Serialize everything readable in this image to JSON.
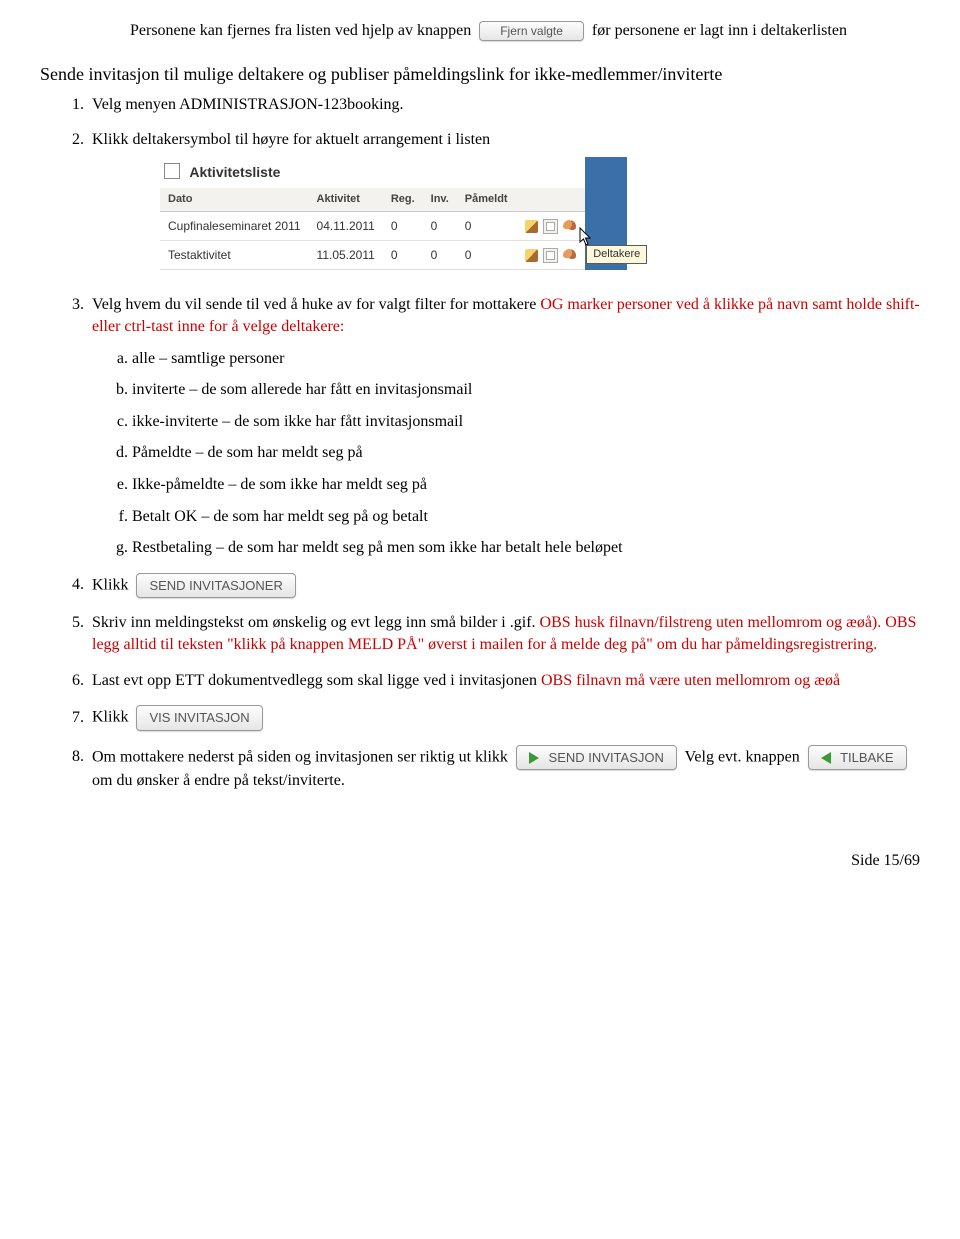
{
  "intro": {
    "part1": "Personene kan fjernes fra listen ved hjelp av knappen ",
    "button_fjern": "Fjern valgte",
    "part2": " før personene er lagt inn i deltakerlisten"
  },
  "heading": "Sende invitasjon til mulige deltakere og publiser påmeldingslink for ikke-medlemmer/inviterte",
  "steps": {
    "s1": "Velg menyen ADMINISTRASJON-123booking.",
    "s2": "Klikk deltakersymbol til høyre for aktuelt arrangement i listen",
    "s3_a": "Velg hvem du vil sende til ved å huke av for valgt filter for mottakere ",
    "s3_b": "OG marker personer ved å klikke på navn samt holde shift- eller ctrl-tast inne for å velge deltakere:",
    "s3_sub": {
      "a": "alle – samtlige personer",
      "b": "inviterte – de som allerede har fått en invitasjonsmail",
      "c": "ikke-inviterte – de som ikke har fått invitasjonsmail",
      "d": "Påmeldte – de som har meldt seg på",
      "e": "Ikke-påmeldte – de som ikke har meldt seg på",
      "f": "Betalt OK – de som har meldt seg på og betalt",
      "g": "Restbetaling – de som har meldt seg på men som ikke har betalt hele beløpet"
    },
    "s4_a": "Klikk ",
    "s4_button": "SEND INVITASJONER",
    "s5_a": "Skriv inn meldingstekst om ønskelig og evt legg inn små bilder i .gif. ",
    "s5_b": "OBS husk filnavn/filstreng uten mellomrom og æøå). OBS legg alltid til teksten \"klikk på knappen MELD PÅ\" øverst i mailen for å melde deg på\" om du har påmeldingsregistrering.",
    "s6_a": "Last evt opp ETT dokumentvedlegg som skal ligge ved i invitasjonen ",
    "s6_b": "OBS filnavn må være uten mellomrom og æøå",
    "s7_a": "Klikk ",
    "s7_button": "VIS INVITASJON",
    "s8_a": "Om mottakere nederst på siden og invitasjonen ser riktig ut klikk ",
    "s8_button": "SEND INVITASJON",
    "s8_b": " Velg evt. knappen ",
    "s8_button2": "TILBAKE",
    "s8_c": " om du ønsker å endre på tekst/inviterte."
  },
  "shot": {
    "title": "Aktivitetsliste",
    "cols": [
      "Dato",
      "Aktivitet",
      "Reg.",
      "Inv.",
      "Påmeldt"
    ],
    "rows": [
      {
        "name": "Cupfinaleseminaret 2011",
        "date": "04.11.2011",
        "reg": "0",
        "inv": "0",
        "pam": "0"
      },
      {
        "name": "Testaktivitet",
        "date": "11.05.2011",
        "reg": "0",
        "inv": "0",
        "pam": "0"
      }
    ],
    "tooltip": "Deltakere"
  },
  "footer": "Side 15/69"
}
